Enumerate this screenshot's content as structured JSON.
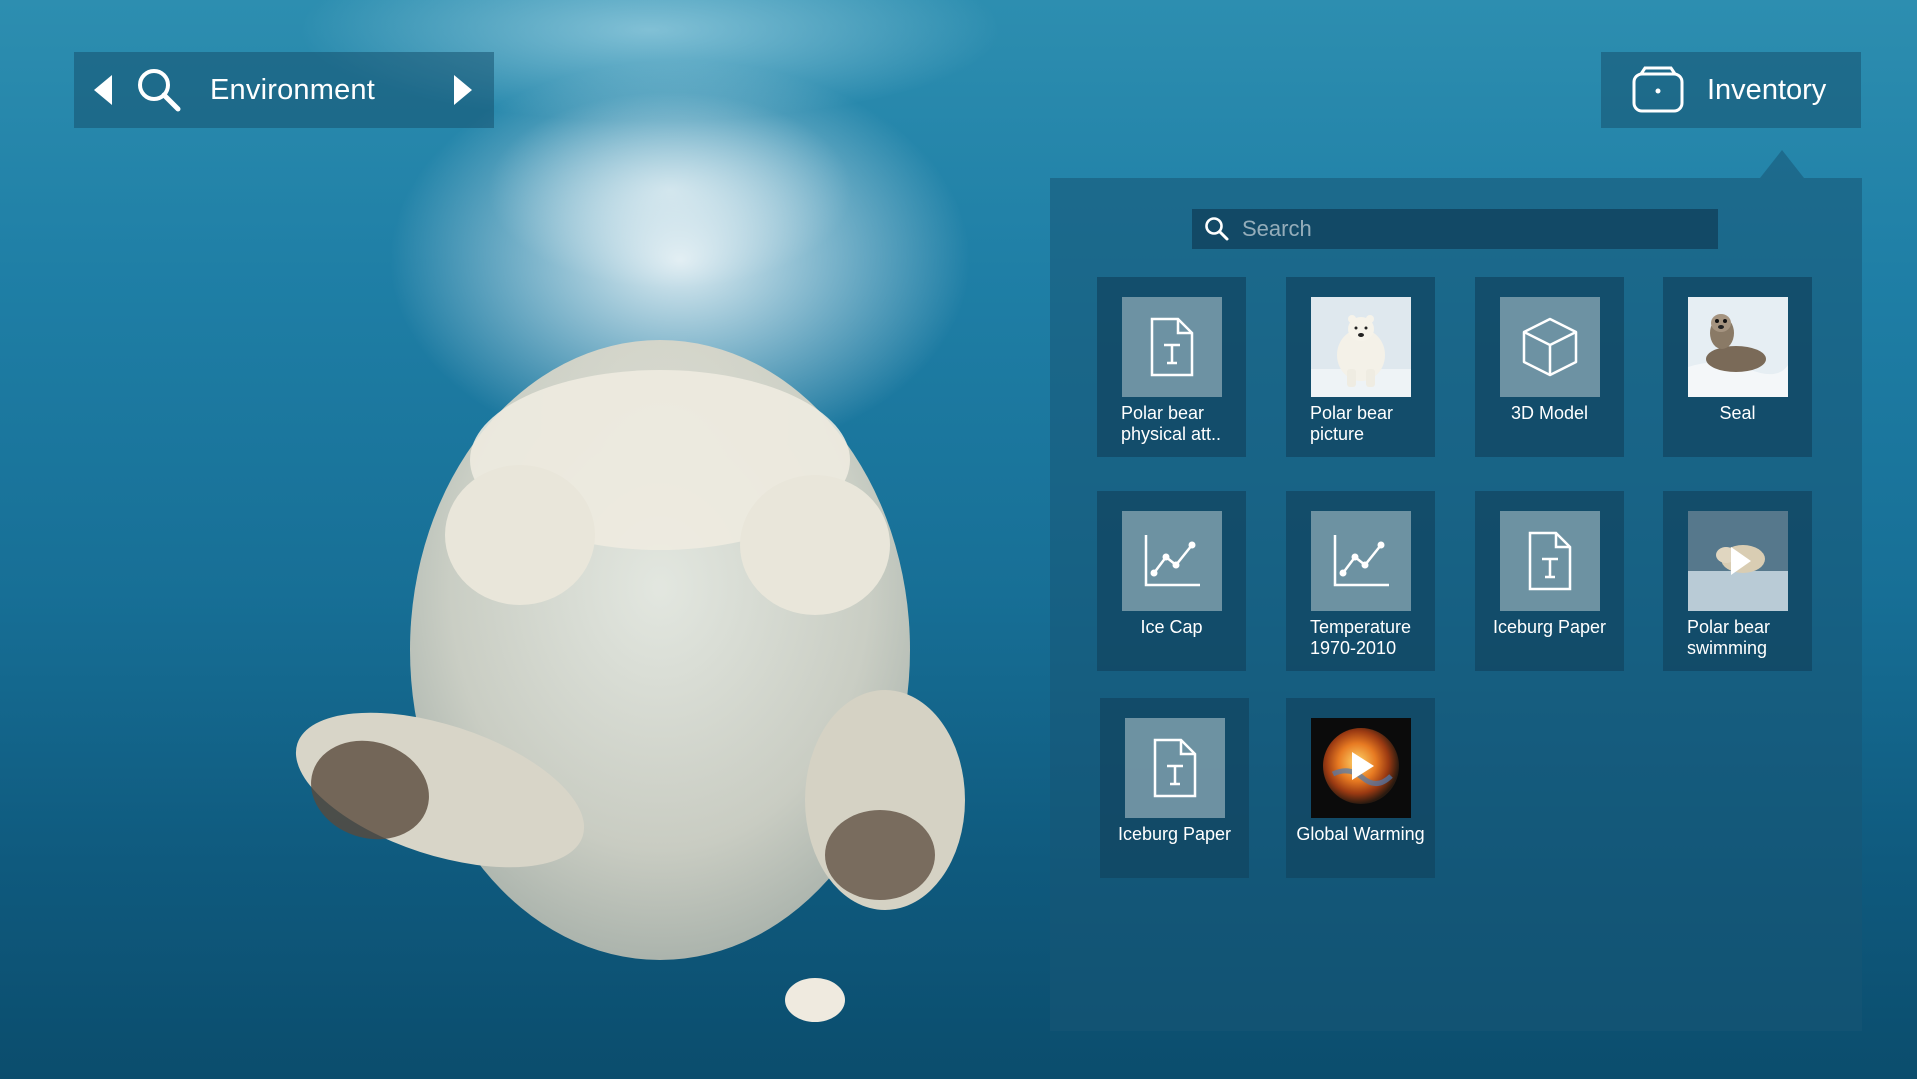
{
  "nav": {
    "title": "Environment",
    "prev_icon": "triangle-left-icon",
    "next_icon": "triangle-right-icon",
    "search_icon": "magnifier-icon"
  },
  "inventory": {
    "label": "Inventory",
    "icon": "inventory-box-icon"
  },
  "search": {
    "placeholder": "Search",
    "value": ""
  },
  "items": [
    {
      "label": "Polar bear physical att..",
      "type": "text-document",
      "icon": "text-document-icon"
    },
    {
      "label": "Polar bear picture",
      "type": "image",
      "icon": "polar-bear-photo"
    },
    {
      "label": "3D Model",
      "type": "model",
      "icon": "cube-icon"
    },
    {
      "label": "Seal",
      "type": "image",
      "icon": "seal-photo"
    },
    {
      "label": "Ice Cap",
      "type": "chart",
      "icon": "line-chart-icon"
    },
    {
      "label": "Temperature 1970-2010",
      "type": "chart",
      "icon": "line-chart-icon"
    },
    {
      "label": "Iceburg Paper",
      "type": "text-document",
      "icon": "text-document-icon"
    },
    {
      "label": "Polar bear swimming",
      "type": "video",
      "icon": "video-play-icon"
    },
    {
      "label": "Iceburg Paper",
      "type": "text-document",
      "icon": "text-document-icon"
    },
    {
      "label": "Global Warming",
      "type": "video",
      "icon": "video-play-icon"
    }
  ],
  "colors": {
    "panel_bg": "#18566f",
    "tile_bg": "#124662",
    "thumb_bg": "#8caab6",
    "text": "#ffffff"
  }
}
